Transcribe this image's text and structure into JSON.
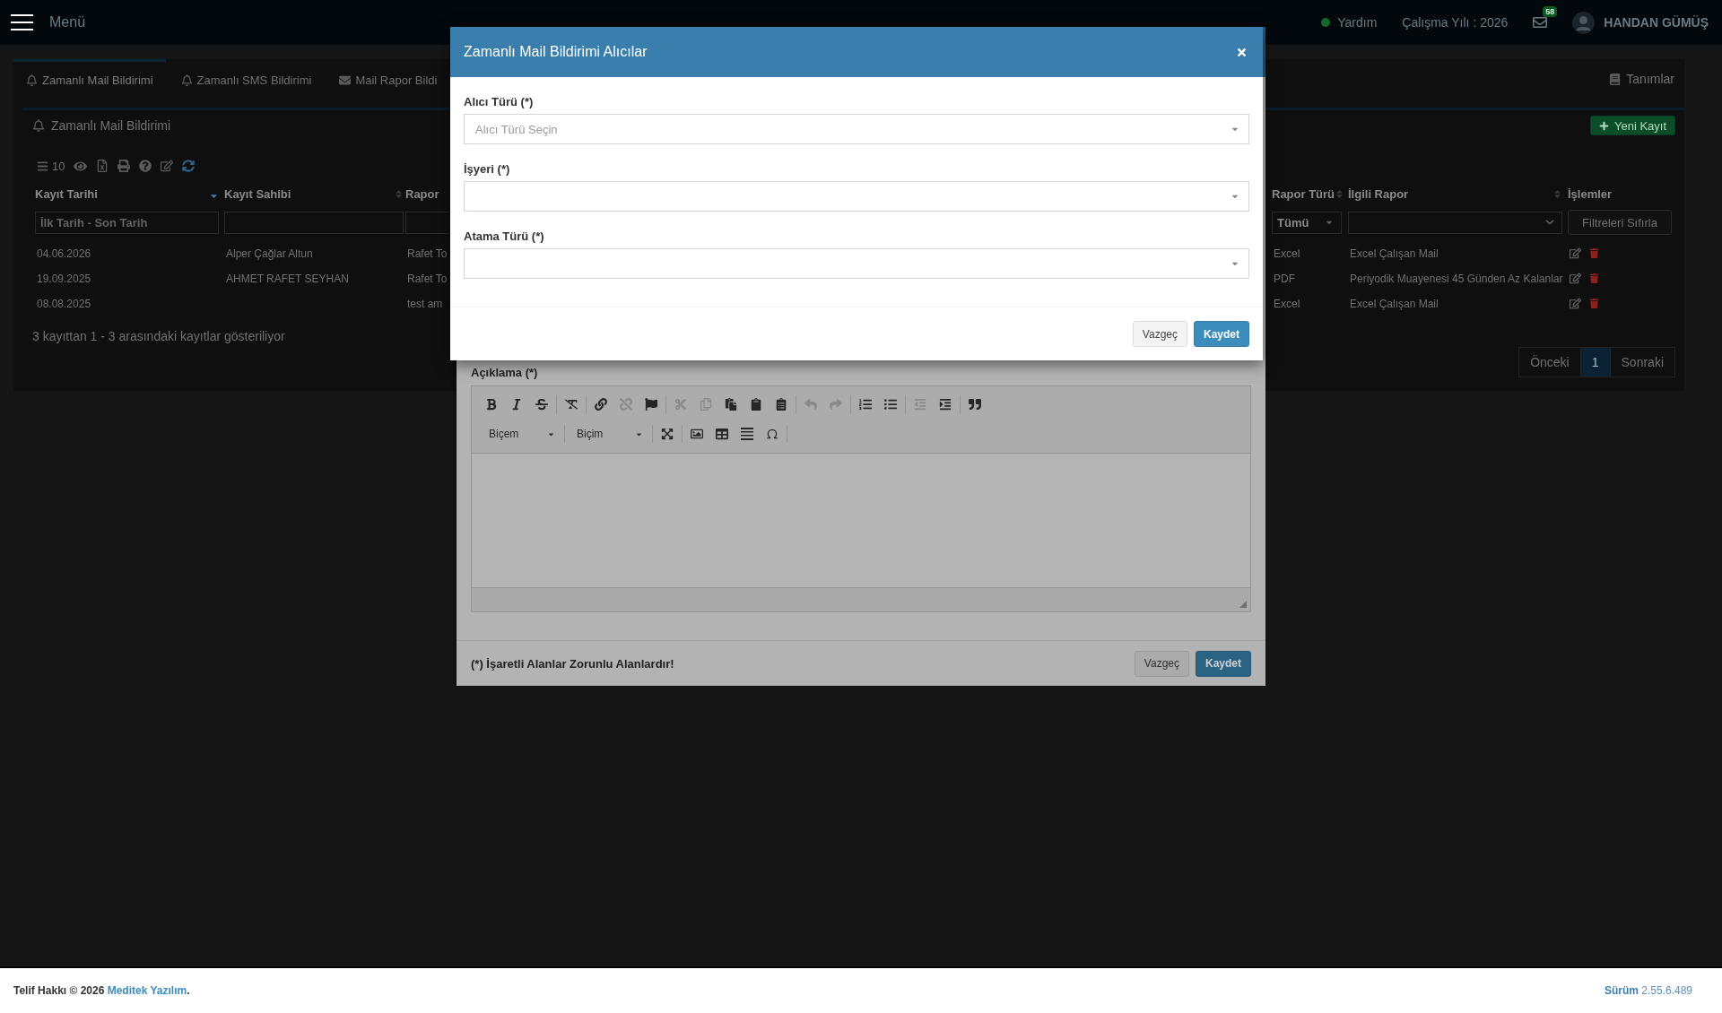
{
  "navbar": {
    "menu_label": "Menü",
    "help": "Yardım",
    "work_year": "Çalışma Yılı : 2026",
    "mail_count": "58",
    "user_name": "HANDAN GÜMÜŞ"
  },
  "tabs": [
    {
      "label": "Zamanlı Mail Bildirimi",
      "selected": true
    },
    {
      "label": "Zamanlı SMS Bildirimi",
      "selected": false
    },
    {
      "label": "Mail Rapor Bildi",
      "selected": false
    }
  ],
  "tab_link": "Tanımlar",
  "panel": {
    "title": "Zamanlı Mail Bildirimi",
    "new_button": "Yeni Kayıt",
    "page_length": "10"
  },
  "table": {
    "columns": [
      {
        "label": "Kayıt Tarihi",
        "sorted": true
      },
      {
        "label": "Kayıt Sahibi",
        "sorted": false
      },
      {
        "label": "Rapor"
      },
      {
        "label": "Rapor Türü",
        "sorted": false
      },
      {
        "label": "İlgili Rapor",
        "sorted": false
      },
      {
        "label": "İşlemler"
      }
    ],
    "filters": [
      {
        "kind": "input",
        "placeholder": "İlk Tarih - Son Tarih"
      },
      {
        "kind": "input"
      },
      {
        "kind": "input"
      },
      {
        "kind": "select",
        "value": "Tümü"
      },
      {
        "kind": "dropdown"
      },
      {
        "kind": "button",
        "label": "Filtreleri Sıfırla"
      }
    ],
    "rows": [
      {
        "date": "04.06.2026",
        "owner": "Alper Çağlar Altun",
        "report": "Rafet To",
        "report_type": "Excel",
        "related_report": "Excel Çalışan Mail"
      },
      {
        "date": "19.09.2025",
        "owner": "AHMET RAFET SEYHAN",
        "report": "Rafet To",
        "report_type": "PDF",
        "related_report": "Periyodik Muayenesi 45 Günden Az Kalanlar"
      },
      {
        "date": "08.08.2025",
        "report": "test am",
        "report_type": "Excel",
        "related_report": "Excel Çalışan Mail"
      }
    ]
  },
  "info": "3 kayıttan 1 - 3 arasındaki kayıtlar gösteriliyor",
  "pagination": {
    "previous": "Önceki",
    "pages": [
      {
        "label": "1",
        "selected": true
      }
    ],
    "next": "Sonraki"
  },
  "form_dialog": {
    "description_label": "Açıklama (*)",
    "editor": {
      "toolbar": [
        [
          {
            "disabled": false
          },
          {
            "disabled": false
          },
          {
            "disabled": false
          }
        ],
        [
          {
            "disabled": false
          }
        ],
        [
          {
            "disabled": false
          },
          {
            "disabled": true
          },
          {
            "disabled": false
          }
        ],
        [
          {
            "disabled": true
          },
          {
            "disabled": true
          },
          {
            "disabled": false
          },
          {
            "disabled": false
          },
          {
            "disabled": false
          }
        ],
        [
          {
            "disabled": true
          },
          {
            "disabled": true
          }
        ],
        [
          {
            "disabled": false
          },
          {
            "disabled": false
          }
        ],
        [
          {
            "disabled": true
          },
          {
            "disabled": false
          }
        ],
        [
          {
            "disabled": false
          }
        ]
      ],
      "style_combo": "Biçem",
      "format_combo": "Biçim",
      "toolbar_2": [
        [
          {
            "disabled": false
          }
        ],
        [
          {
            "disabled": false
          },
          {
            "disabled": false
          },
          {
            "disabled": false
          },
          {
            "disabled": false
          }
        ]
      ]
    },
    "required_note": "(*) İşaretli Alanlar Zorunlu Alanlardır!",
    "buttons": [
      {
        "label": "Vazgeç",
        "kind": "default"
      },
      {
        "label": "Kaydet",
        "kind": "primary"
      }
    ]
  },
  "recipient_dialog": {
    "title": "Zamanlı Mail Bildirimi Alıcılar",
    "fields": [
      {
        "label": "Alıcı Türü (*)",
        "placeholder": "Alıcı Türü Seçin"
      },
      {
        "label": "İşyeri (*)"
      },
      {
        "label": "Atama Türü (*)"
      }
    ],
    "buttons": [
      {
        "label": "Vazgeç",
        "kind": "default"
      },
      {
        "label": "Kaydet",
        "kind": "primary"
      }
    ]
  },
  "footer": {
    "copyright": "Telif Hakkı © 2026",
    "company": "Meditek Yazılım",
    "end": ".",
    "version_label": "Sürüm",
    "version": "2.55.6.489"
  }
}
